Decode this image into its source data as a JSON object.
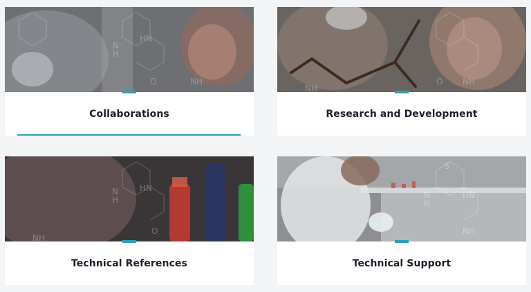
{
  "theme": {
    "accent": "#2a9fb5",
    "title_color": "#1a1f2b",
    "card_bg": "#ffffff",
    "page_bg": "#f3f4f6"
  },
  "cards": [
    {
      "title": "Collaborations",
      "image": "lab-scientist-with-pipette-photo",
      "underlined": true
    },
    {
      "title": "Research and Development",
      "image": "researcher-with-molecular-model-photo",
      "underlined": false
    },
    {
      "title": "Technical References",
      "image": "colored-test-tubes-photo",
      "underlined": false
    },
    {
      "title": "Technical Support",
      "image": "laboratory-bench-photo",
      "underlined": false
    }
  ]
}
